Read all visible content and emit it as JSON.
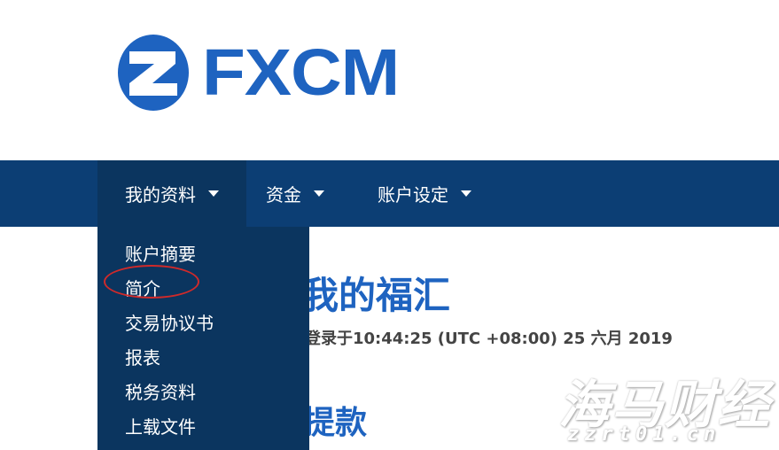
{
  "logo": {
    "text": "FXCM",
    "color": "#1e63c0"
  },
  "nav": {
    "items": [
      {
        "label": "我的资料",
        "icon": "caret-down-icon"
      },
      {
        "label": "资金",
        "icon": "caret-down-icon"
      },
      {
        "label": "账户设定",
        "icon": "caret-down-icon"
      }
    ]
  },
  "dropdown": {
    "items": [
      "账户摘要",
      "简介",
      "交易协议书",
      "报表",
      "税务资料",
      "上载文件"
    ],
    "highlighted": "简介"
  },
  "content": {
    "title": "我的福汇",
    "login_text": "登录于10:44:25 (UTC +08:00) 25 六月 2019",
    "subtitle": "提款"
  },
  "watermark": {
    "text": "海马财经",
    "url": "zzrt01.cn"
  },
  "colors": {
    "navbar": "#0c3e74",
    "dropdown": "#0b355f",
    "accent": "#1e63c0",
    "annotation": "#d02a2a"
  }
}
